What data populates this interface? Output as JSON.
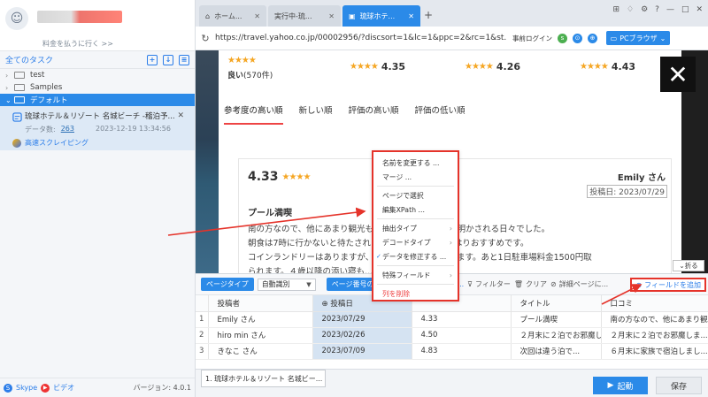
{
  "sidebar": {
    "upgrade_link": "料金を払うに行く >>",
    "tasks_title": "全てのタスク",
    "folders": [
      {
        "label": "test"
      },
      {
        "label": "Samples"
      },
      {
        "label": "デフォルト"
      }
    ],
    "task": {
      "name": "琉球ホテル＆リゾート 名城ビーチ -稽泊予...",
      "count_label": "データ数:",
      "count": "263",
      "timestamp": "2023-12-19 13:34:56",
      "action": "高速スクレイピング"
    },
    "footer": {
      "skype": "Skype",
      "video": "ビデオ",
      "version": "バージョン: 4.0.1"
    }
  },
  "tabs": [
    {
      "label": "ホーム..."
    },
    {
      "label": "実行中-琉..."
    },
    {
      "label": "琉球ホテ..."
    }
  ],
  "address": {
    "url": "https://travel.yahoo.co.jp/00002956/?discsort=1&lc=1&ppc=2&rc=1&st...",
    "login": "事前ログイン",
    "pc_browser": "PCブラウザ"
  },
  "webpage": {
    "ratings": [
      {
        "value": "4.35"
      },
      {
        "value": "4.26"
      },
      {
        "value": "4.43"
      }
    ],
    "good_label": "良い",
    "good_count": "(570件)",
    "sort_options": [
      "参考度の高い順",
      "新しい順",
      "評価の高い順",
      "評価の低い順"
    ],
    "review": {
      "score": "4.33",
      "name": "Emily さん",
      "date": "投稿日: 2023/07/29",
      "title": "プール満喫",
      "body_lines": [
        "南の方なので、他にあまり観光も...いためプール三昧に明かされる日々でした。",
        "朝食は7時に行かないと待たされ...料理しても早めがやはりおすすめです。",
        "コインランドリーはありますが、...までで500円かかります。あと1日駐車場料金1500円取",
        "られます。４歳以降の添い寝も...ます。"
      ]
    },
    "fold_label": "折る"
  },
  "context_menu": {
    "items": [
      {
        "label": "名前を変更する ..."
      },
      {
        "label": "マージ ..."
      },
      {
        "label": "ページで選択"
      },
      {
        "label": "編集XPath ..."
      },
      {
        "label": "抽出タイプ"
      },
      {
        "label": "デコードタイプ"
      },
      {
        "label": "データを修正する ..."
      },
      {
        "label": "特殊フィールド"
      },
      {
        "label": "列を削除"
      }
    ]
  },
  "data_panel": {
    "page_type_label": "ページタイプ",
    "page_type_value": "自動識別",
    "page_number_label": "ページ番号の設定",
    "scrape_label": "スクレ...",
    "filter": "フィルター",
    "clear": "クリア",
    "detail_link": "詳細ページに...",
    "add_field": "フィールドを追加",
    "columns": [
      "投稿者",
      "投稿日",
      "",
      "タイトル",
      "口コミ"
    ],
    "rows": [
      {
        "no": "1",
        "c1": "Emily さん",
        "c2": "2023/07/29",
        "c3": "4.33",
        "c4": "プール満喫",
        "c5": "南の方なので、他にあまり観..."
      },
      {
        "no": "2",
        "c1": "hiro min さん",
        "c2": "2023/02/26",
        "c3": "4.50",
        "c4": "２月末に２泊でお邪魔しま...",
        "c5": "２月末に２泊でお邪魔しま..."
      },
      {
        "no": "3",
        "c1": "きなこ さん",
        "c2": "2023/07/09",
        "c3": "4.83",
        "c4": "次回は違う泊で...",
        "c5": "６月末に家族で宿泊しまし..."
      }
    ]
  },
  "bottom": {
    "task_tab": "1. 琉球ホテル＆リゾート 名城ビー...",
    "start": "起動",
    "save": "保存"
  },
  "colors": {
    "accent": "#2b8ae8",
    "highlight_red": "#e5332a"
  }
}
